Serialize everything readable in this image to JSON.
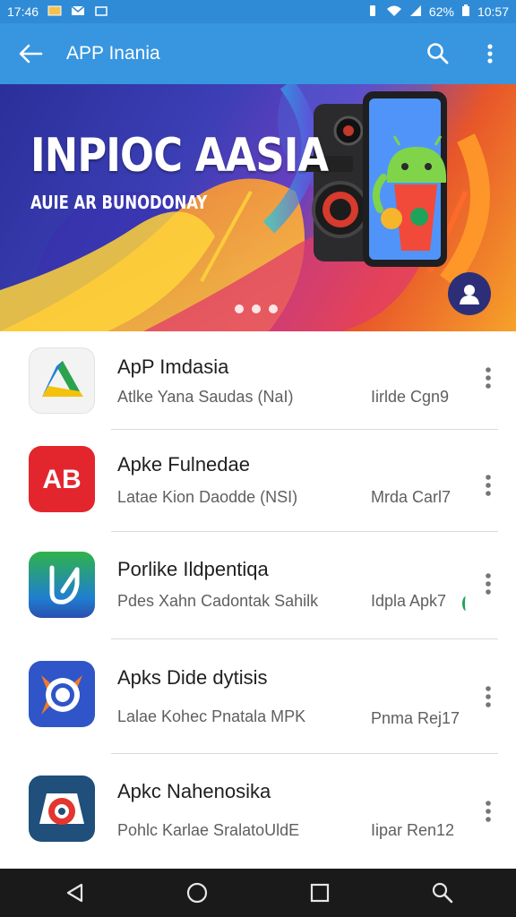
{
  "status_bar": {
    "time": "17:46",
    "battery": "62%",
    "clock_right": "10:57"
  },
  "app_bar": {
    "title": "APP Inania",
    "icons": [
      "back-arrow-icon",
      "search-icon",
      "more-vert-icon"
    ]
  },
  "banner": {
    "title": "INPIOC AASIA",
    "subtitle": "AUIE AR BUNODONAY",
    "page_dots": 3,
    "colors": {
      "start": "#2a2f9a",
      "mid": "#6a3fc0",
      "end": "#f6a22a"
    }
  },
  "apps": [
    {
      "title": "ApP Imdasia",
      "subtitle": "Atlke Yana Saudas (NaI)",
      "meta": "Iirlde Cgn9",
      "icon": "drive-triangle-icon"
    },
    {
      "title": "Apke Fulnedae",
      "subtitle": "Latae Kion Daodde (NSI)",
      "meta": "Mrda Carl7",
      "icon": "ab-logo-icon"
    },
    {
      "title": "Porlike Ildpentiqa",
      "subtitle": "Pdes Xahn Cadontak Sahilk",
      "meta": "Idpla Apk7",
      "icon": "leaf-logo-icon"
    },
    {
      "title": "Apks Dide dytisis",
      "subtitle": "Lalae Kohec Pnatala MPK",
      "meta": "Pnma Rej17",
      "icon": "target-logo-icon"
    },
    {
      "title": "Apkc Nahenosika",
      "subtitle": "Pohlc Karlae SralatoUldE",
      "meta": "Iipar Ren12",
      "icon": "ring-logo-icon"
    }
  ],
  "nav_bar": {
    "icons": [
      "back-triangle-icon",
      "home-circle-icon",
      "recents-square-icon",
      "search-icon"
    ]
  }
}
